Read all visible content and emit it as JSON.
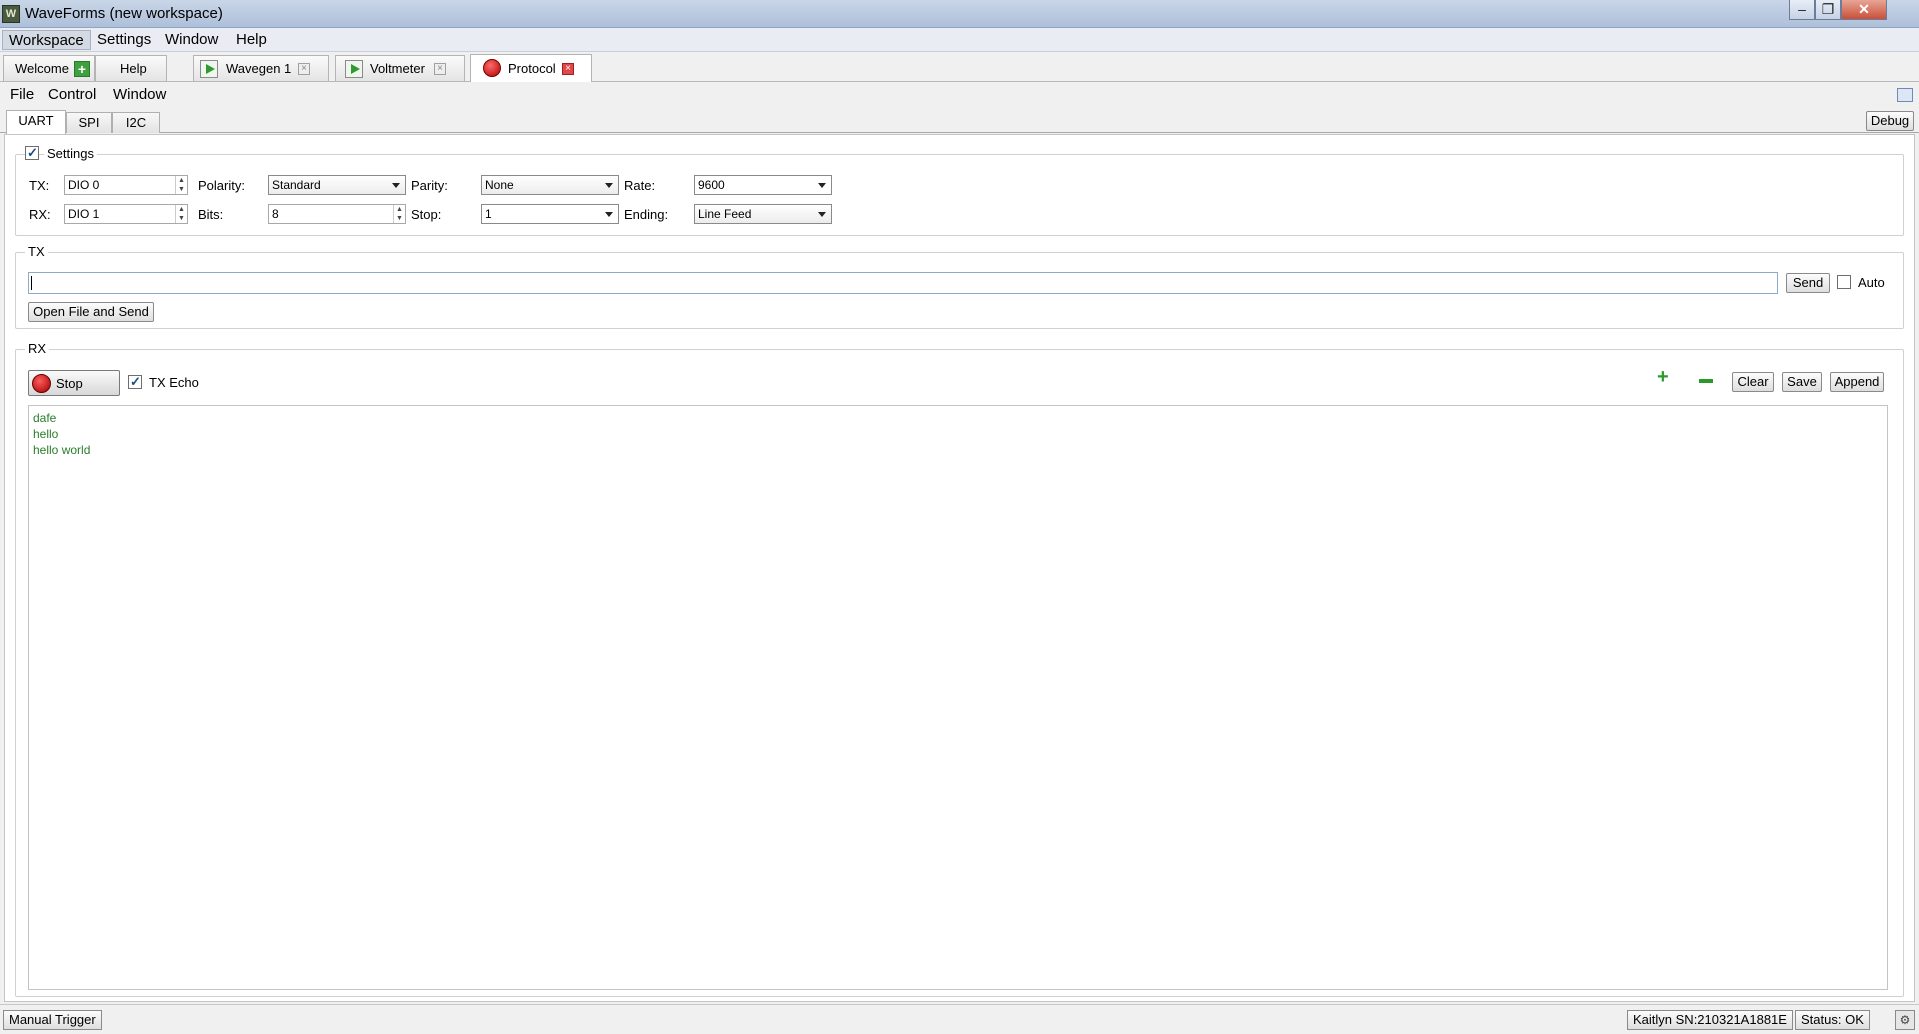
{
  "window": {
    "title": "WaveForms  (new workspace)",
    "app_icon": "waveforms-logo-icon"
  },
  "menubar": {
    "items": [
      "Workspace",
      "Settings",
      "Window",
      "Help"
    ]
  },
  "doc_tabs": [
    {
      "label": "Welcome",
      "icon": "plus-icon"
    },
    {
      "label": "Help"
    },
    {
      "label": "Wavegen 1",
      "icon": "play-icon"
    },
    {
      "label": "Voltmeter",
      "icon": "play-icon"
    },
    {
      "label": "Protocol",
      "icon": "record-icon",
      "active": true
    }
  ],
  "instrument_menu": {
    "items": [
      "File",
      "Control",
      "Window"
    ]
  },
  "protocol_tabs": {
    "tabs": [
      "UART",
      "SPI",
      "I2C"
    ],
    "active": "UART",
    "debug_label": "Debug"
  },
  "settings": {
    "label": "Settings",
    "enabled": true,
    "tx_label": "TX:",
    "tx_value": "DIO 0",
    "rx_label": "RX:",
    "rx_value": "DIO 1",
    "polarity_label": "Polarity:",
    "polarity_value": "Standard",
    "bits_label": "Bits:",
    "bits_value": "8",
    "parity_label": "Parity:",
    "parity_value": "None",
    "stop_label": "Stop:",
    "stop_value": "1",
    "rate_label": "Rate:",
    "rate_value": "9600",
    "ending_label": "Ending:",
    "ending_value": "Line Feed"
  },
  "tx": {
    "title": "TX",
    "input_value": "",
    "send_label": "Send",
    "auto_label": "Auto",
    "auto_checked": false,
    "open_file_label": "Open File and Send"
  },
  "rx": {
    "title": "RX",
    "stop_label": "Stop",
    "tx_echo_label": "TX Echo",
    "tx_echo_checked": true,
    "clear_label": "Clear",
    "save_label": "Save",
    "append_label": "Append",
    "lines": [
      "dafe",
      "hello",
      "hello world"
    ],
    "text_color": "#2a7d2a"
  },
  "statusbar": {
    "manual_trigger_label": "Manual Trigger",
    "device_label": "Kaitlyn SN:210321A1881E",
    "status_label": "Status: OK"
  }
}
